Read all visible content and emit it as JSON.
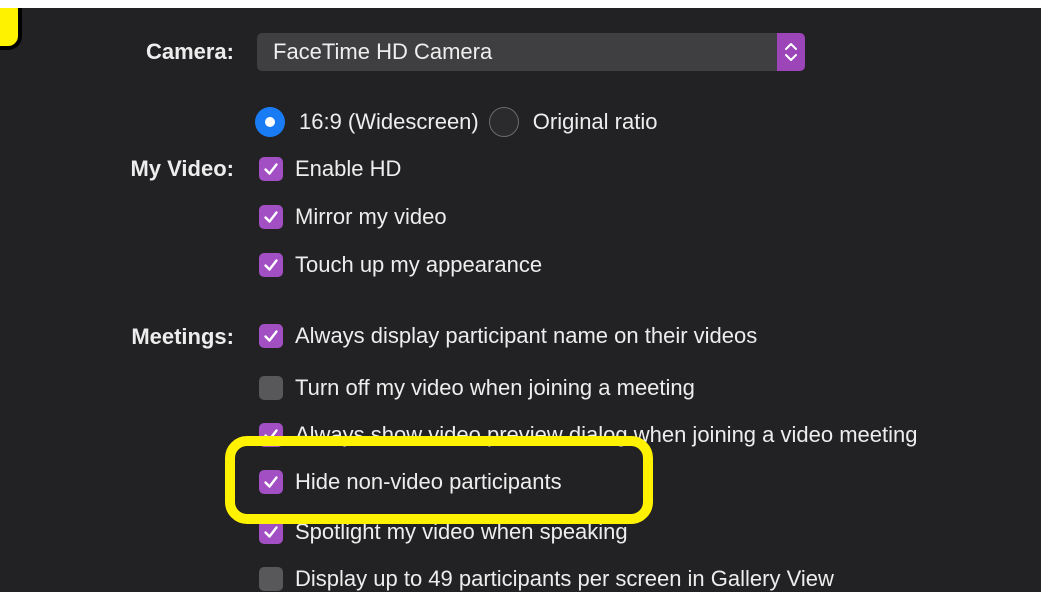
{
  "camera": {
    "label": "Camera:",
    "selected": "FaceTime HD Camera"
  },
  "my_video": {
    "label": "My Video:",
    "aspect_options": [
      {
        "label": "16:9 (Widescreen)",
        "selected": true
      },
      {
        "label": "Original ratio",
        "selected": false
      }
    ],
    "options": [
      {
        "label": "Enable HD",
        "checked": true
      },
      {
        "label": "Mirror my video",
        "checked": true
      },
      {
        "label": "Touch up my appearance",
        "checked": true
      }
    ]
  },
  "meetings": {
    "label": "Meetings:",
    "options": [
      {
        "label": "Always display participant name on their videos",
        "checked": true
      },
      {
        "label": "Turn off my video when joining a meeting",
        "checked": false
      },
      {
        "label": "Always show video preview dialog when joining a video meeting",
        "checked": true
      },
      {
        "label": "Hide non-video participants",
        "checked": true
      },
      {
        "label": "Spotlight my video when speaking",
        "checked": true
      },
      {
        "label": "Display up to 49 participants per screen in Gallery View",
        "checked": false
      }
    ]
  },
  "colors": {
    "background": "#222123",
    "accent": "#a14fc3",
    "radio_selected": "#1a7cf5",
    "highlight": "#fff200"
  },
  "icons": {
    "select_arrows": "chevron-up-down-icon",
    "check": "checkmark-icon"
  }
}
